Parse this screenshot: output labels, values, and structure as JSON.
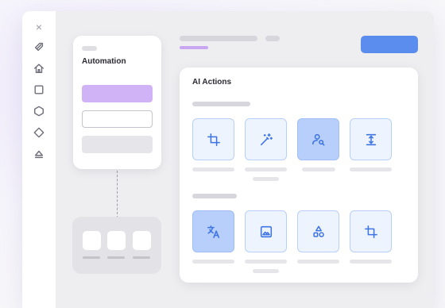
{
  "sidebar": {
    "close_glyph": "×",
    "icons": [
      "tag-icon",
      "home-icon",
      "square-icon",
      "hexagon-icon",
      "diamond-icon",
      "eject-icon"
    ]
  },
  "automation_card": {
    "title": "Automation"
  },
  "ai_panel": {
    "title": "AI Actions",
    "row1": [
      "crop-icon",
      "magic-wand-icon",
      "person-search-icon",
      "vertical-align-icon"
    ],
    "row2": [
      "translate-icon",
      "image-icon",
      "shapes-icon",
      "crop-icon"
    ],
    "active_tiles": [
      "person-search-icon",
      "translate-icon"
    ]
  },
  "colors": {
    "accent_blue": "#5b8def",
    "accent_purple": "#d0b3f6",
    "tile_bg": "#eef4fe",
    "tile_active_bg": "#b7cffa",
    "icon_blue": "#3d74e4"
  }
}
